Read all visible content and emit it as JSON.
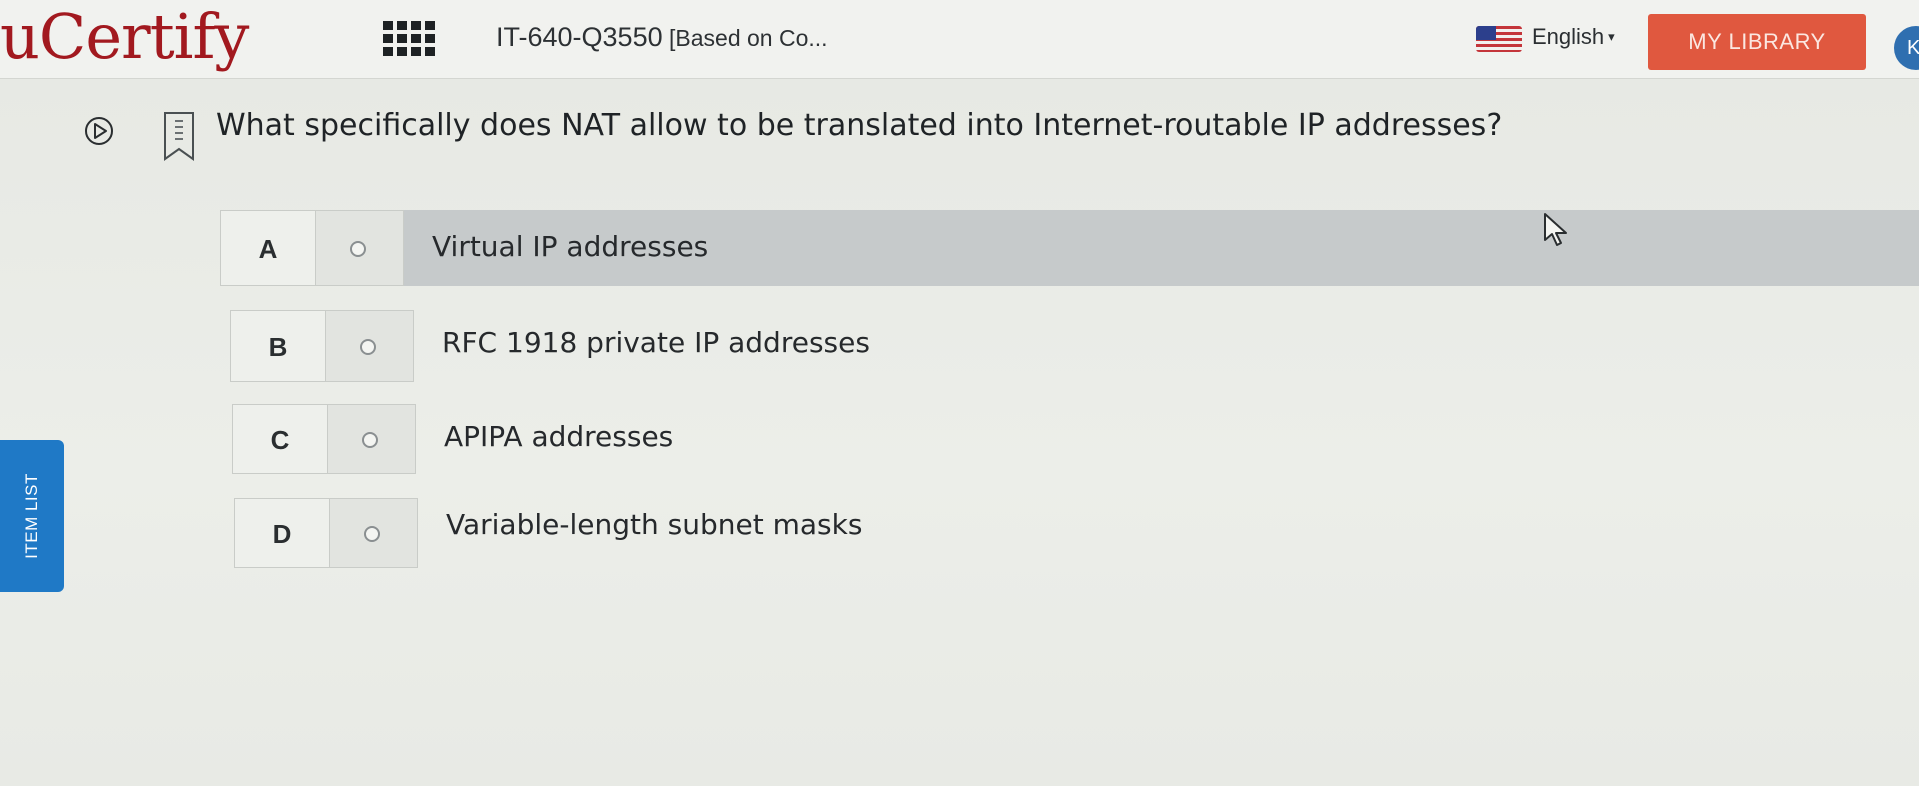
{
  "header": {
    "logo_text": "uCertify",
    "apps_icon": "grid-apps-icon",
    "course_title": "IT-640-Q3550",
    "course_title_suffix": " [Based on Co...",
    "language_flag_icon": "us-flag-icon",
    "language_label": "English",
    "language_caret": "▾",
    "library_button_label": "MY LIBRARY",
    "avatar_initial": "K",
    "library_button_color": "#e0583f"
  },
  "question": {
    "play_icon": "play-circle-icon",
    "bookmark_icon": "bookmark-icon",
    "text": "What specifically does NAT allow to be translated into Internet-routable IP addresses?"
  },
  "options": [
    {
      "letter": "A",
      "text": "Virtual IP addresses",
      "highlighted": true
    },
    {
      "letter": "B",
      "text": "RFC 1918 private IP addresses",
      "highlighted": false
    },
    {
      "letter": "C",
      "text": "APIPA addresses",
      "highlighted": false
    },
    {
      "letter": "D",
      "text": "Variable-length subnet masks",
      "highlighted": false
    }
  ],
  "item_list_tab": {
    "label": "ITEM LIST",
    "color": "#1f79c6"
  }
}
